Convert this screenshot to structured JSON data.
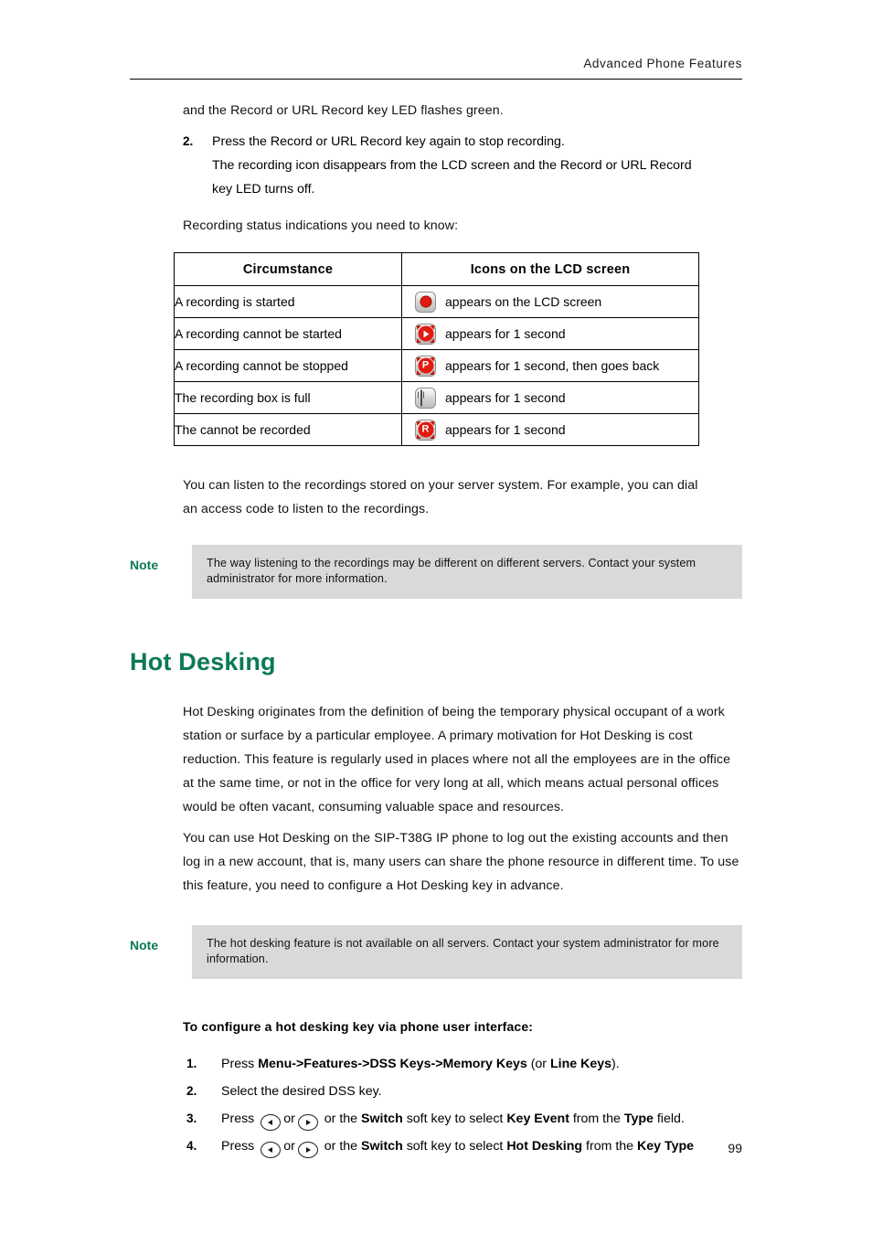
{
  "header": {
    "running_title": "Advanced  Phone  Features"
  },
  "top_section": {
    "continuation_line": "and the Record  or URL Record  key LED flashes green.",
    "step": {
      "number": "2.",
      "line1": "Press the Record or URL  Record key again to stop recording.",
      "line2": "The recording icon  disappears from the LCD screen and the Record  or URL Record",
      "line3": "key LED turns off."
    },
    "table_intro": "Recording  status indications  you need to know:"
  },
  "status_table": {
    "headers": [
      "Circumstance",
      "Icons on the LCD screen"
    ],
    "rows": [
      {
        "circumstance": "A recording is started",
        "icon": "record-dot-icon",
        "description": "appears on the LCD screen"
      },
      {
        "circumstance": "A recording cannot be started",
        "icon": "record-start-failed-icon",
        "description": "appears for 1 second"
      },
      {
        "circumstance": "A recording cannot be stopped",
        "icon": "record-pause-failed-icon",
        "description": "appears for 1 second, then goes back"
      },
      {
        "circumstance": "The recording box is full",
        "icon": "trash-full-icon",
        "description": "appears for 1 second"
      },
      {
        "circumstance": "The cannot be recorded",
        "icon": "record-denied-icon",
        "description": "appears for 1 second"
      }
    ]
  },
  "after_table": {
    "line1": "You can listen to the recordings stored on your server system. For example, you can dial",
    "line2": "an access code to listen to the recordings."
  },
  "note_1": {
    "label": "Note",
    "text": "The way listening to the recordings may be different  on different  servers. Contact your system  administrator  for more information."
  },
  "hot_desking": {
    "title": "Hot Desking",
    "paragraph_1": "Hot Desking originates from the definition of being the temporary physical occupant of a work station or surface by a particular employee. A primary motivation for Hot Desking is cost reduction.  This feature is regularly used in places where not all the employees are in the office at the same time, or not in the office for very long at all, which means actual personal offices would be often vacant, consuming valuable space and resources.",
    "paragraph_2": "You can use Hot Desking on the SIP-T38G IP phone to log out the existing accounts and then log in a new account,  that is, many users can share the phone  resource in different time. To use this feature, you need to configure a Hot Desking key in advance."
  },
  "note_2": {
    "label": "Note",
    "text": "The hot desking feature is not available on all servers. Contact your system administrator for more information."
  },
  "procedure": {
    "title": "To configure a hot desking key via phone user interface:",
    "steps": [
      {
        "number": "1.",
        "pre": "Press ",
        "bold_1": "Menu",
        "sep_1": "->",
        "bold_2": "Features",
        "sep_2": "->",
        "bold_3": "DSS Keys",
        "sep_3": "->",
        "bold_4": "Memory Keys",
        "mid": " (or ",
        "bold_5": "Line Keys",
        "post": ")."
      },
      {
        "number": "2.",
        "text": "Select the desired DSS key."
      },
      {
        "number": "3.",
        "pre": "Press ",
        "or": "or",
        "mid_1": " or the ",
        "bold_switch": "Switch",
        "mid_2": " soft key to select ",
        "bold_value": "Key Event",
        "mid_3": " from the ",
        "bold_field": "Type",
        "post": " field."
      },
      {
        "number": "4.",
        "pre": "Press ",
        "or": "or",
        "mid_1": " or the ",
        "bold_switch": "Switch",
        "mid_2": " soft key to select ",
        "bold_value": "Hot Desking",
        "mid_3": " from the ",
        "bold_field": "Key Type",
        "post": ""
      }
    ]
  },
  "footer": {
    "page_number": "99"
  },
  "colors": {
    "accent_green": "#0b7a52",
    "note_background": "#d9d9d9",
    "icon_red": "#e01b10",
    "text": "#111111"
  }
}
